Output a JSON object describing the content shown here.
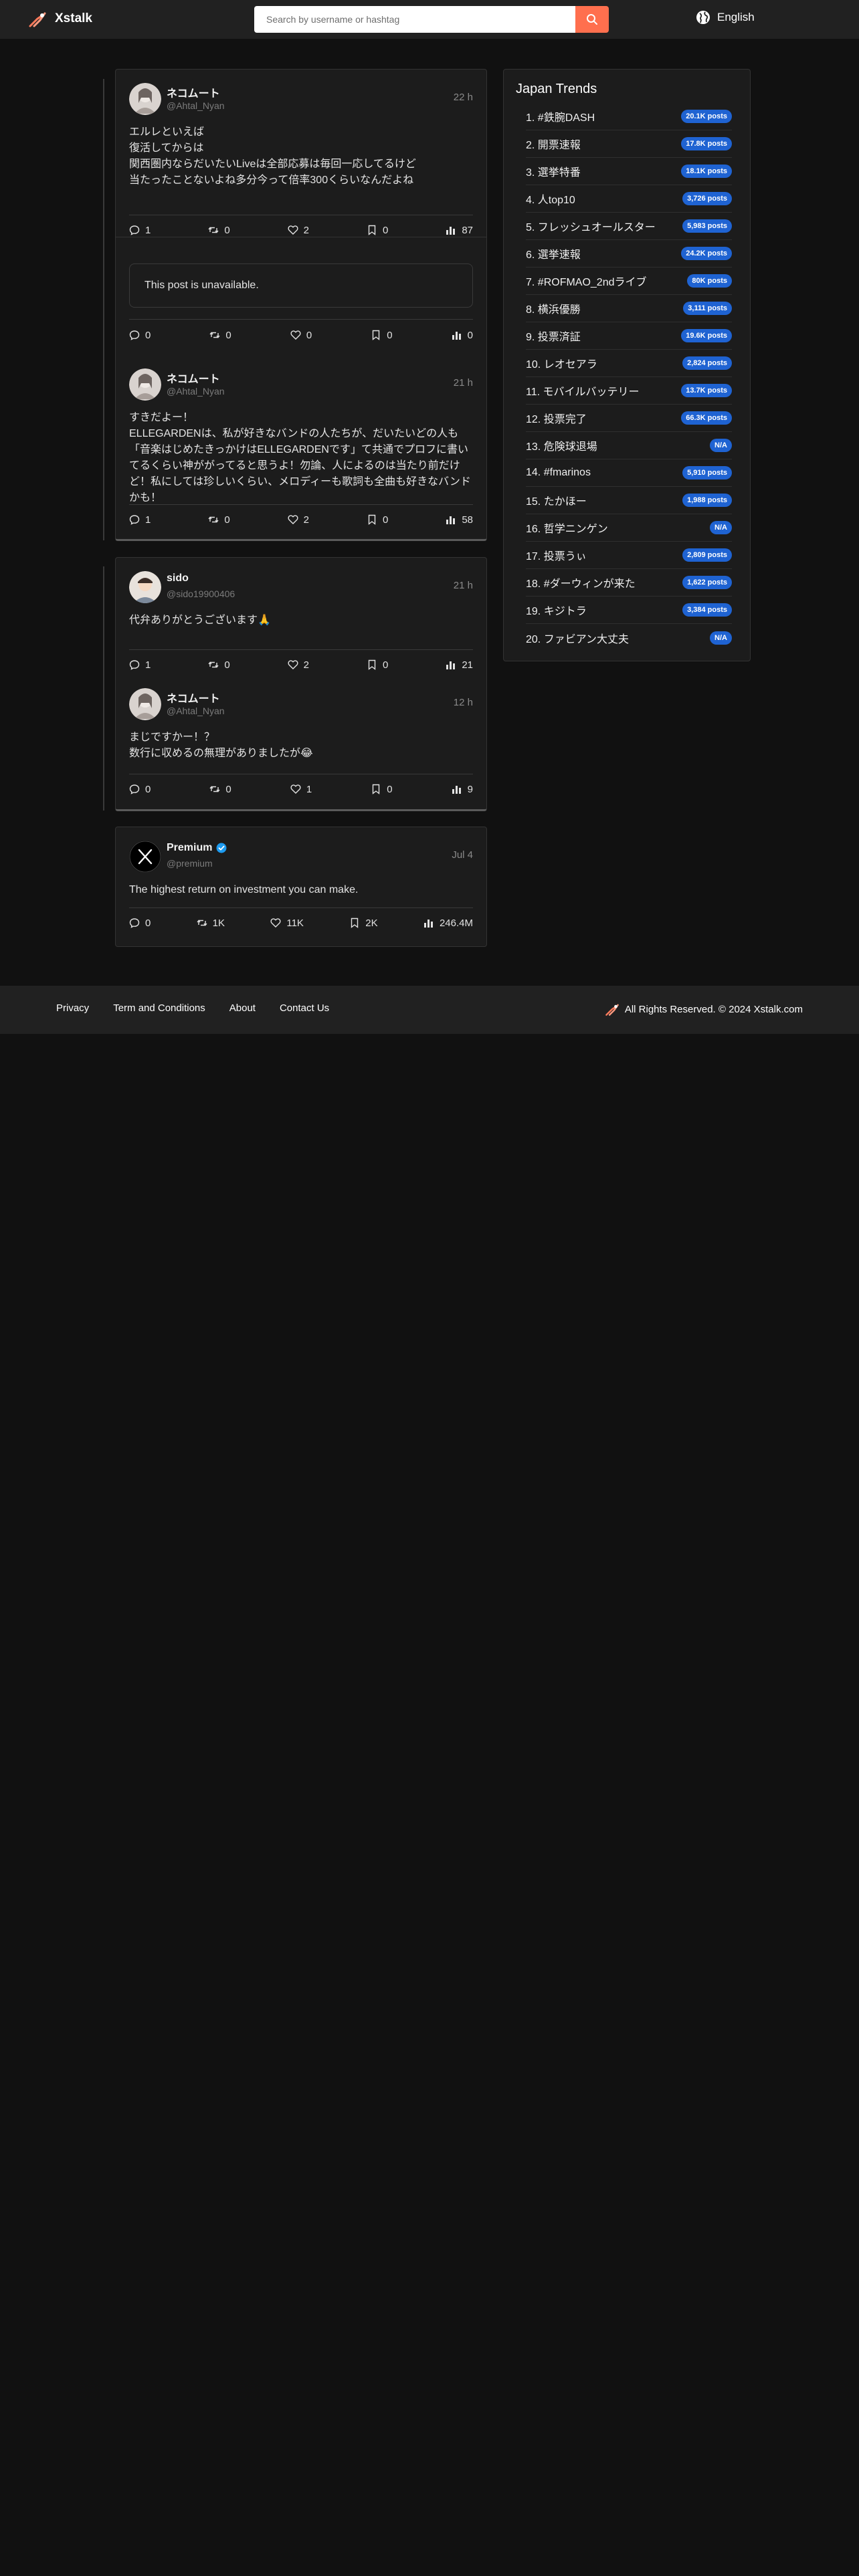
{
  "header": {
    "brand": "Xstalk",
    "search_placeholder": "Search by username or hashtag",
    "language": "English"
  },
  "threads": [
    {
      "posts": [
        {
          "name": "ネコムート",
          "handle": "@Ahtal_Nyan",
          "time": "22 h",
          "text": "エルレといえば\n復活してからは\n関西圏内ならだいたいLiveは全部応募は毎回一応してるけど\n当たったことないよね多分今って倍率300くらいなんだよね",
          "stats": {
            "replies": "1",
            "reposts": "0",
            "likes": "2",
            "bookmarks": "0",
            "views": "87"
          }
        },
        {
          "unavailable": "This post is unavailable.",
          "stats": {
            "replies": "0",
            "reposts": "0",
            "likes": "0",
            "bookmarks": "0",
            "views": "0"
          }
        },
        {
          "name": "ネコムート",
          "handle": "@Ahtal_Nyan",
          "time": "21 h",
          "text": "すきだよー！\nELLEGARDENは、私が好きなバンドの人たちが、だいたいどの人も「音楽はじめたきっかけはELLEGARDENです」て共通でプロフに書いてるくらい神ががってると思うよ！勿論、人によるのは当たり前だけど！私にしては珍しいくらい、メロディーも歌詞も全曲も好きなバンドかも！",
          "stats": {
            "replies": "1",
            "reposts": "0",
            "likes": "2",
            "bookmarks": "0",
            "views": "58"
          }
        }
      ]
    },
    {
      "posts": [
        {
          "name": "sido",
          "handle": "@sido19900406",
          "time": "21 h",
          "text": "代弁ありがとうございます🙏",
          "stats": {
            "replies": "1",
            "reposts": "0",
            "likes": "2",
            "bookmarks": "0",
            "views": "21"
          }
        },
        {
          "name": "ネコムート",
          "handle": "@Ahtal_Nyan",
          "time": "12 h",
          "text": "まじですかー！？\n数行に収めるの無理がありましたが😂",
          "stats": {
            "replies": "0",
            "reposts": "0",
            "likes": "1",
            "bookmarks": "0",
            "views": "9"
          }
        }
      ]
    },
    {
      "posts": [
        {
          "name": "Premium",
          "handle": "@premium",
          "time": "Jul 4",
          "text": "The highest return on investment you can make.",
          "stats": {
            "replies": "0",
            "reposts": "1K",
            "likes": "11K",
            "bookmarks": "2K",
            "views": "246.4M"
          }
        }
      ]
    }
  ],
  "trends": {
    "title": "Japan Trends",
    "items": [
      {
        "label": "1. #鉄腕DASH",
        "count": "20.1K posts"
      },
      {
        "label": "2. 開票速報",
        "count": "17.8K posts"
      },
      {
        "label": "3. 選挙特番",
        "count": "18.1K posts"
      },
      {
        "label": "4. 人top10",
        "count": "3,726 posts"
      },
      {
        "label": "5. フレッシュオールスター",
        "count": "5,983 posts"
      },
      {
        "label": "6. 選挙速報",
        "count": "24.2K posts"
      },
      {
        "label": "7. #ROFMAO_2ndライブ",
        "count": "80K posts"
      },
      {
        "label": "8. 横浜優勝",
        "count": "3,111 posts"
      },
      {
        "label": "9. 投票済証",
        "count": "19.6K posts"
      },
      {
        "label": "10. レオセアラ",
        "count": "2,824 posts"
      },
      {
        "label": "11. モバイルバッテリー",
        "count": "13.7K posts"
      },
      {
        "label": "12. 投票完了",
        "count": "66.3K posts"
      },
      {
        "label": "13. 危険球退場",
        "count": "N/A"
      },
      {
        "label": "14. #fmarinos",
        "count": "5,910 posts"
      },
      {
        "label": "15. たかほー",
        "count": "1,988 posts"
      },
      {
        "label": "16. 哲学ニンゲン",
        "count": "N/A"
      },
      {
        "label": "17. 投票うぃ",
        "count": "2,809 posts"
      },
      {
        "label": "18. #ダーウィンが来た",
        "count": "1,622 posts"
      },
      {
        "label": "19. キジトラ",
        "count": "3,384 posts"
      },
      {
        "label": "20. ファビアン大丈夫",
        "count": "N/A"
      }
    ]
  },
  "footer": {
    "links": [
      "Privacy",
      "Term and Conditions",
      "About",
      "Contact Us"
    ],
    "copyright": "All Rights Reserved. © 2024 Xstalk.com"
  },
  "colors": {
    "accent": "#ff6f4e",
    "badge": "#1f63d2",
    "verified": "#1d9bf0"
  }
}
